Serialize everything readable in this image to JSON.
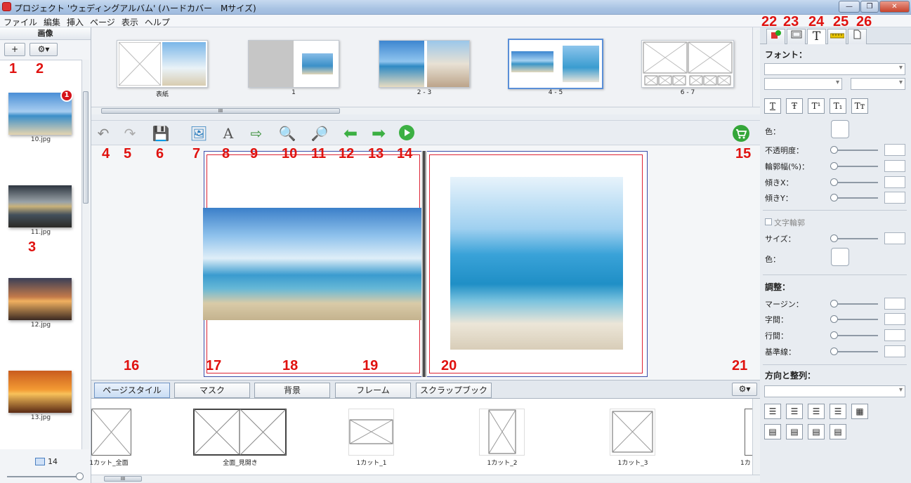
{
  "window": {
    "title": "プロジェクト 'ウェディングアルバム' (ハードカバー　Mサイズ)",
    "btn_minimize": "—",
    "btn_maximize": "❐",
    "btn_close": "✕"
  },
  "menu": [
    "ファイル",
    "編集",
    "挿入",
    "ページ",
    "表示",
    "ヘルプ"
  ],
  "left_panel": {
    "header": "画像",
    "add_btn": "+",
    "gear_btn": "⚙▾",
    "badge": "1",
    "thumbnails": [
      "10.jpg",
      "11.jpg",
      "12.jpg",
      "13.jpg"
    ],
    "count": "14"
  },
  "page_strip": {
    "spreads": [
      {
        "label": "表紙"
      },
      {
        "label": "1"
      },
      {
        "label": "2 - 3"
      },
      {
        "label": "4 - 5"
      },
      {
        "label": "6 - 7"
      }
    ],
    "scroll_grip": "III"
  },
  "bottom_tabs": [
    "ページスタイル",
    "マスク",
    "背景",
    "フレーム",
    "スクラップブック"
  ],
  "bottom_gear": "⚙▾",
  "templates": [
    "1カット_全面",
    "全面_見開き",
    "1カット_1",
    "1カット_2",
    "1カット_3",
    "1カ"
  ],
  "right_panel": {
    "font_header": "フォント：",
    "style_buttons": [
      "T",
      "Ŧ",
      "T¹",
      "T₁",
      "Tт"
    ],
    "color_label": "色：",
    "opacity_label": "不透明度：",
    "outline_width_label": "輪郭幅(%)：",
    "skew_x_label": "傾きX：",
    "skew_y_label": "傾きY：",
    "text_outline_label": "文字輪郭",
    "size_label": "サイズ：",
    "color2_label": "色：",
    "adjust_header": "調整：",
    "margin_label": "マージン：",
    "char_spacing_label": "字間：",
    "line_spacing_label": "行間：",
    "baseline_label": "基準線：",
    "align_header": "方向と整列："
  },
  "annotations": [
    "1",
    "2",
    "3",
    "4",
    "5",
    "6",
    "7",
    "8",
    "9",
    "10",
    "11",
    "12",
    "13",
    "14",
    "15",
    "16",
    "17",
    "18",
    "19",
    "20",
    "21",
    "22",
    "23",
    "24",
    "25",
    "26"
  ],
  "colors": {
    "accent": "#5a8fd8",
    "annotation": "#e0120f"
  }
}
